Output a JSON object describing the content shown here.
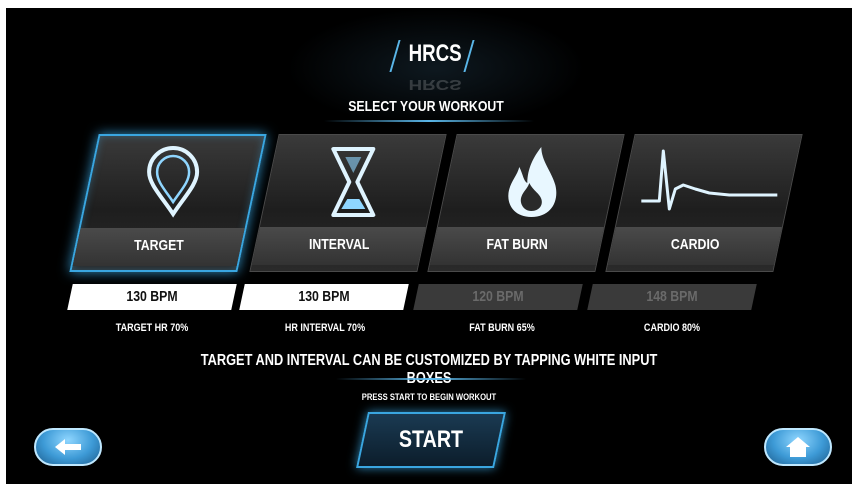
{
  "header": {
    "title": "HRCS",
    "subtitle": "SELECT YOUR WORKOUT"
  },
  "workouts": [
    {
      "label": "TARGET",
      "icon": "map-pin-icon",
      "bpm": "130 BPM",
      "editable": true,
      "caption": "TARGET HR 70%",
      "selected": true
    },
    {
      "label": "INTERVAL",
      "icon": "hourglass-icon",
      "bpm": "130 BPM",
      "editable": true,
      "caption": "HR INTERVAL 70%",
      "selected": false
    },
    {
      "label": "FAT BURN",
      "icon": "flame-icon",
      "bpm": "120 BPM",
      "editable": false,
      "caption": "FAT BURN 65%",
      "selected": false
    },
    {
      "label": "CARDIO",
      "icon": "heartbeat-icon",
      "bpm": "148 BPM",
      "editable": false,
      "caption": "CARDIO 80%",
      "selected": false
    }
  ],
  "hint": "TARGET AND INTERVAL CAN BE CUSTOMIZED BY TAPPING WHITE INPUT BOXES",
  "press_start": "PRESS START TO BEGIN WORKOUT",
  "start_label": "START",
  "nav": {
    "back_icon": "arrow-left-icon",
    "home_icon": "home-icon"
  },
  "colors": {
    "accent": "#3aa6e0",
    "background": "#000000",
    "card": "#2a2a2a",
    "input_active": "#ffffff",
    "input_inactive": "#3a3a3a"
  }
}
